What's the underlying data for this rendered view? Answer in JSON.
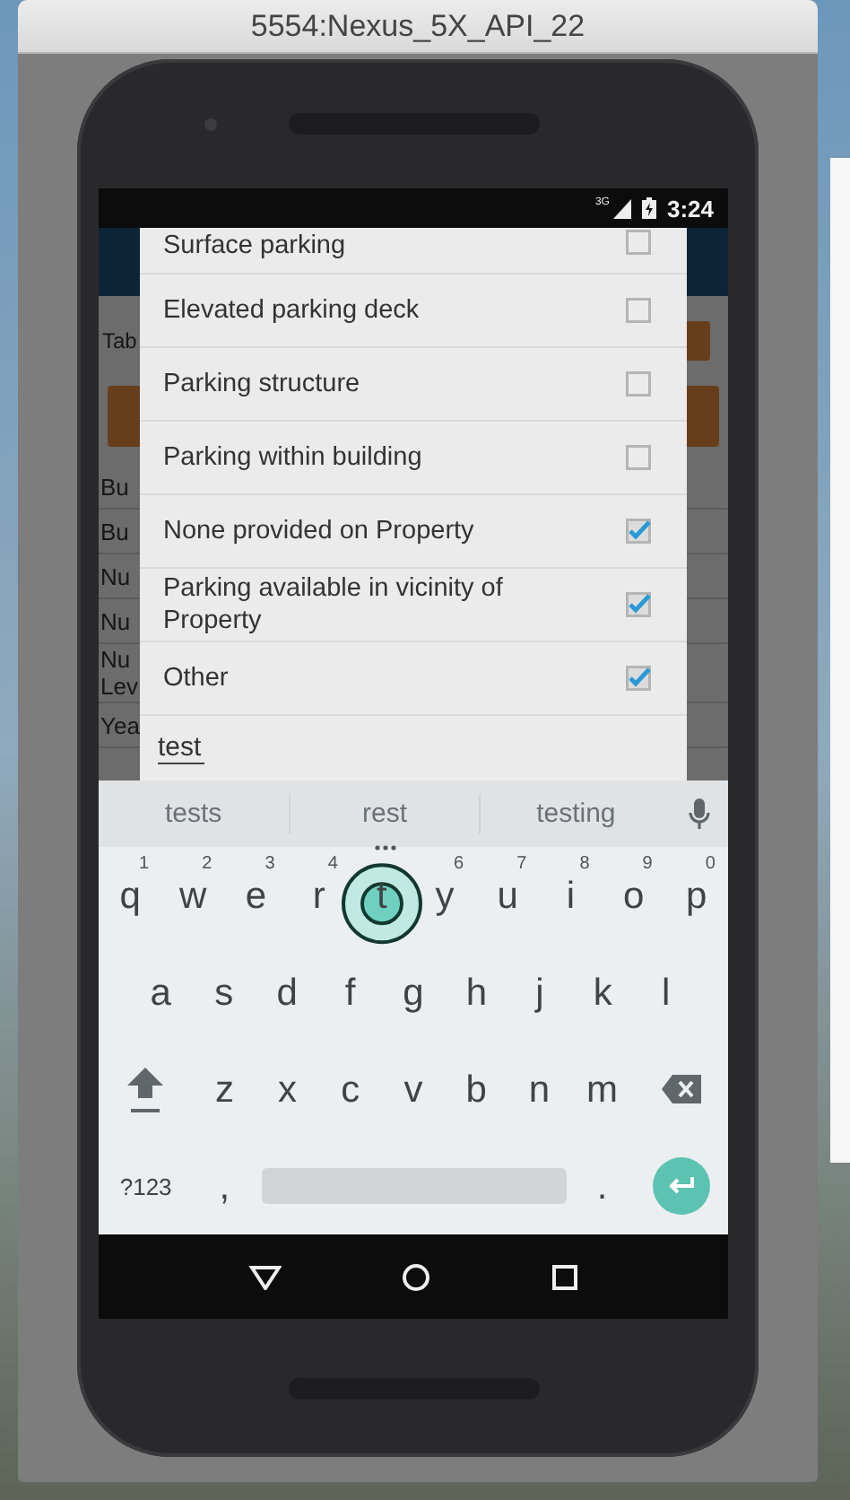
{
  "window": {
    "title": "5554:Nexus_5X_API_22"
  },
  "status_bar": {
    "network": "3G",
    "time": "3:24"
  },
  "background_form": {
    "tab_label": "Tab",
    "rows": [
      {
        "lines": [
          "Bu"
        ]
      },
      {
        "lines": [
          "Bu"
        ]
      },
      {
        "lines": [
          "Nu"
        ]
      },
      {
        "lines": [
          "Nu"
        ]
      },
      {
        "lines": [
          "Nu",
          "Lev"
        ]
      },
      {
        "lines": [
          "Yea"
        ]
      }
    ]
  },
  "dialog": {
    "options": [
      {
        "label": "Surface parking",
        "checked": false
      },
      {
        "label": "Elevated parking deck",
        "checked": false
      },
      {
        "label": "Parking structure",
        "checked": false
      },
      {
        "label": "Parking within building",
        "checked": false
      },
      {
        "label": "None provided on Property",
        "checked": true
      },
      {
        "label": "Parking available in vicinity of Property",
        "checked": true
      },
      {
        "label": "Other",
        "checked": true
      }
    ],
    "input": {
      "value": "test"
    }
  },
  "keyboard": {
    "suggestions": [
      {
        "text": "tests",
        "more": false
      },
      {
        "text": "rest",
        "more": true
      },
      {
        "text": "testing",
        "more": false
      }
    ],
    "rows": [
      {
        "keys": [
          {
            "kind": "char",
            "label": "q",
            "hint": "1"
          },
          {
            "kind": "char",
            "label": "w",
            "hint": "2"
          },
          {
            "kind": "char",
            "label": "e",
            "hint": "3"
          },
          {
            "kind": "char",
            "label": "r",
            "hint": "4"
          },
          {
            "kind": "char",
            "label": "t",
            "pressed": true
          },
          {
            "kind": "char",
            "label": "y",
            "hint": "6"
          },
          {
            "kind": "char",
            "label": "u",
            "hint": "7"
          },
          {
            "kind": "char",
            "label": "i",
            "hint": "8"
          },
          {
            "kind": "char",
            "label": "o",
            "hint": "9"
          },
          {
            "kind": "char",
            "label": "p",
            "hint": "0"
          }
        ]
      },
      {
        "keys": [
          {
            "kind": "char",
            "label": "a"
          },
          {
            "kind": "char",
            "label": "s"
          },
          {
            "kind": "char",
            "label": "d"
          },
          {
            "kind": "char",
            "label": "f"
          },
          {
            "kind": "char",
            "label": "g"
          },
          {
            "kind": "char",
            "label": "h"
          },
          {
            "kind": "char",
            "label": "j"
          },
          {
            "kind": "char",
            "label": "k"
          },
          {
            "kind": "char",
            "label": "l"
          }
        ]
      },
      {
        "keys": [
          {
            "kind": "shift"
          },
          {
            "kind": "char",
            "label": "z"
          },
          {
            "kind": "char",
            "label": "x"
          },
          {
            "kind": "char",
            "label": "c"
          },
          {
            "kind": "char",
            "label": "v"
          },
          {
            "kind": "char",
            "label": "b"
          },
          {
            "kind": "char",
            "label": "n"
          },
          {
            "kind": "char",
            "label": "m"
          },
          {
            "kind": "backspace"
          }
        ]
      },
      {
        "keys": [
          {
            "kind": "symbols",
            "label": "?123"
          },
          {
            "kind": "char",
            "label": ","
          },
          {
            "kind": "space"
          },
          {
            "kind": "char",
            "label": "."
          },
          {
            "kind": "enter"
          }
        ]
      }
    ]
  }
}
